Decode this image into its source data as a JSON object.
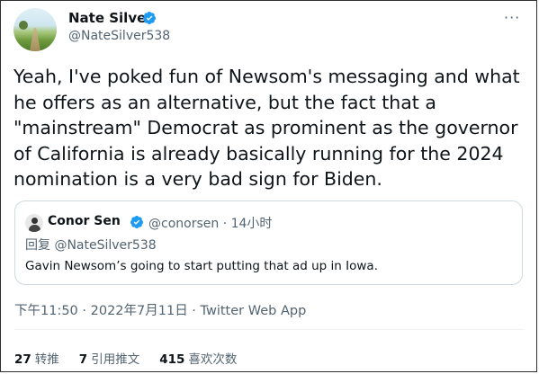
{
  "author": {
    "name": "Nate Silver",
    "handle": "@NateSilver538"
  },
  "tweet": {
    "text": "Yeah, I've poked fun of Newsom's messaging and what\nhe offers as an alternative, but the fact that a\n\"mainstream\" Democrat as prominent as the governor\nof California is already basically running for the 2024\nnomination is a very bad sign for Biden."
  },
  "quoted": {
    "name": "Conor Sen",
    "handle_time": "@conorsen · 14小时",
    "reply_to": "回复 @NateSilver538",
    "text": "Gavin Newsom’s going to start putting that ad up in Iowa."
  },
  "meta": {
    "timestamp_source": "下午11:50 · 2022年7月11日 · Twitter Web App"
  },
  "stats": {
    "retweets_count": "27",
    "retweets_label": "转推",
    "quotes_count": "7",
    "quotes_label": "引用推文",
    "likes_count": "415",
    "likes_label": "喜欢次数"
  },
  "icons": {
    "verified": "verified-badge-icon",
    "more": "more-options-icon"
  },
  "colors": {
    "verified_blue": "#1d9bf0",
    "secondary_text": "#536471",
    "primary_text": "#0f1419"
  }
}
